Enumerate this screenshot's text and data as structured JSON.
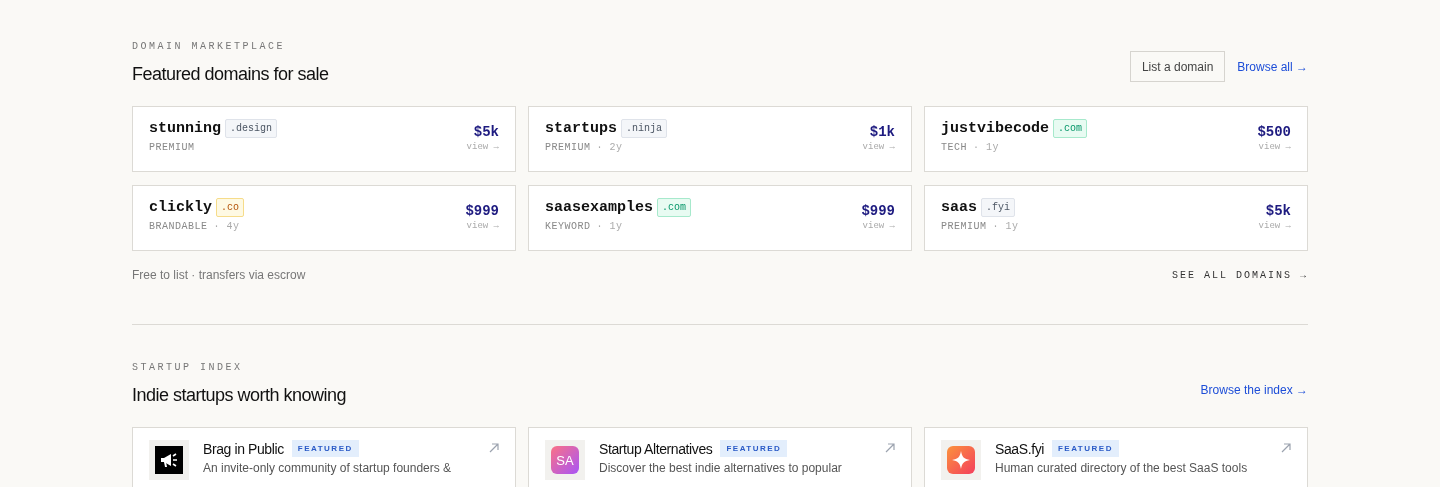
{
  "domains_section": {
    "eyebrow": "DOMAIN MARKETPLACE",
    "title": "Featured domains for sale",
    "list_button": "List a domain",
    "browse_link": "Browse all →",
    "domains": [
      {
        "name": "stunning",
        "tld": ".design",
        "color": "#f4f6f9",
        "category": "PREMIUM",
        "price": "$5k",
        "view": "view →"
      },
      {
        "name": "startups",
        "tld": ".ninja",
        "color": "#f4f6f9",
        "category": "PREMIUM",
        "age": "· 2y",
        "price": "$1k",
        "view": "view →"
      },
      {
        "name": "justvibecode",
        "tld": ".com",
        "color": "#e8fbf2",
        "category": "TECH",
        "age": "· 1y",
        "price": "$500",
        "view": "view →"
      },
      {
        "name": "clickly",
        "tld": ".co",
        "color": "#fef9e3",
        "category": "BRANDABLE",
        "age": "· 4y",
        "price": "$999",
        "view": "view →"
      },
      {
        "name": "saasexamples",
        "tld": ".com",
        "color": "#e8fbf2",
        "category": "KEYWORD",
        "age": "· 1y",
        "price": "$999",
        "view": "view →"
      },
      {
        "name": "saas",
        "tld": ".fyi",
        "color": "#f4f6f9",
        "category": "PREMIUM",
        "age": "· 1y",
        "price": "$5k",
        "view": "view →"
      }
    ],
    "footnote": "Free to list · transfers via escrow",
    "see_all": "SEE ALL DOMAINS →"
  },
  "startups_section": {
    "eyebrow": "STARTUP INDEX",
    "title": "Indie startups worth knowing",
    "browse_link": "Browse the index →",
    "startups": [
      {
        "name": "Brag in Public",
        "badge": "FEATURED",
        "kind": "megaphone",
        "description": "An invite-only community of startup founders &"
      },
      {
        "name": "Startup Alternatives",
        "badge": "FEATURED",
        "kind": "initials",
        "logo_text": "SA",
        "description": "Discover the best indie alternatives to popular"
      },
      {
        "name": "SaaS.fyi",
        "badge": "FEATURED",
        "kind": "sparkle",
        "description": "Human curated directory of the best SaaS tools"
      }
    ]
  }
}
